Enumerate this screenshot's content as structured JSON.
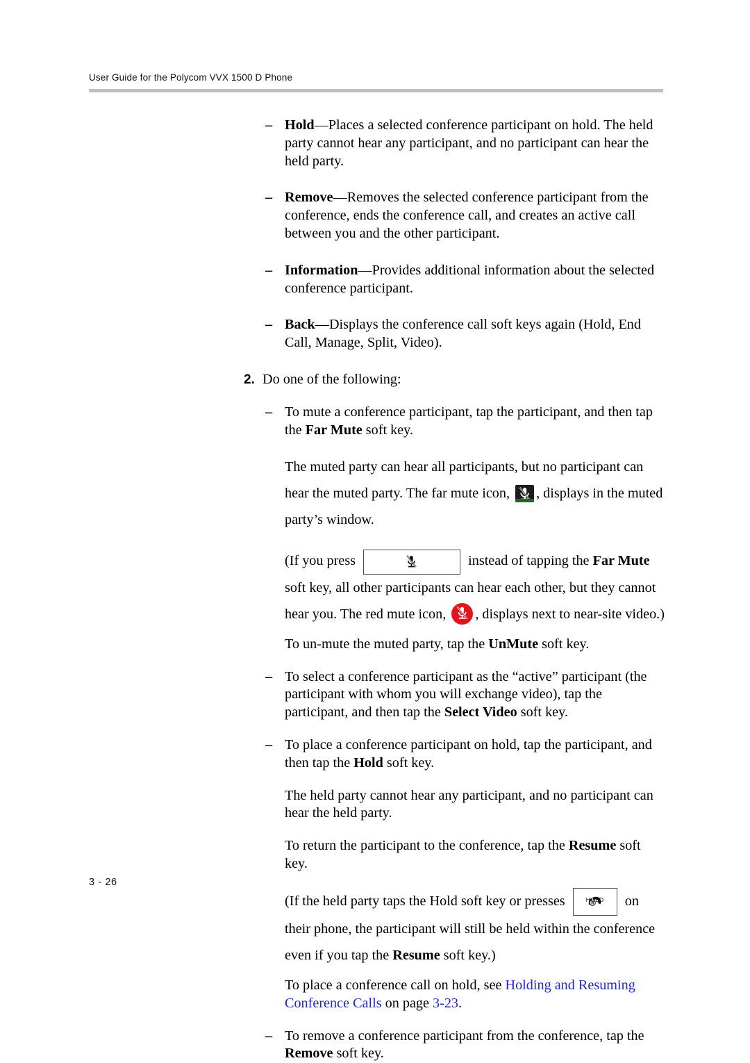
{
  "header": {
    "title": "User Guide for the Polycom VVX 1500 D Phone"
  },
  "footer": {
    "page_number": "3 - 26"
  },
  "colors": {
    "rule": "#bfbfbf",
    "link": "#2222dd",
    "red_mute": "#e8131a",
    "far_mute_bg": "#1c1c1c",
    "far_mute_accent": "#1d6b1d"
  },
  "bullets_softkeys": [
    {
      "marker": "–",
      "term": "Hold",
      "sep": "—",
      "text": "Places a selected conference participant on hold. The held party cannot hear any participant, and no participant can hear the held party."
    },
    {
      "marker": "–",
      "term": "Remove",
      "sep": "—",
      "text": "Removes the selected conference participant from the conference, ends the conference call, and creates an active call between you and the other participant."
    },
    {
      "marker": "–",
      "term": "Information",
      "sep": "—",
      "text": "Provides additional information about the selected conference participant."
    },
    {
      "marker": "–",
      "term": "Back",
      "sep": "—",
      "text": "Displays the conference call soft keys again (Hold, End Call, Manage, Split, Video)."
    }
  ],
  "step": {
    "number": "2.",
    "text": "Do one of the following:"
  },
  "mute_bullet": {
    "marker": "–",
    "lead": "To mute a conference participant, tap the participant, and then tap the ",
    "softkey": "Far Mute",
    "tail": " soft key."
  },
  "mute_body": {
    "line1": "The muted party can hear all participants, but no participant can hear",
    "line2_a": "the muted party. The far mute icon, ",
    "line2_b": ", displays in the muted",
    "line3": "party’s window."
  },
  "mute_key_note": {
    "a": "(If you press ",
    "b": " instead of tapping the ",
    "softkey": "Far Mute",
    "c": " soft key, all other participants can hear each other, but they cannot hear you. The red mute icon, ",
    "d": ", displays next to near-site video.)"
  },
  "unmute_line": {
    "a": "To un-mute the muted party, tap the ",
    "softkey": "UnMute",
    "b": " soft key."
  },
  "select_video_bullet": {
    "marker": "–",
    "a": "To select a conference participant as the “active” participant (the participant with whom you will exchange video), tap the participant, and then tap the ",
    "softkey": "Select Video",
    "b": " soft key."
  },
  "hold_bullet": {
    "marker": "–",
    "a": "To place a conference participant on hold, tap the participant, and then tap the ",
    "softkey": "Hold",
    "b": " soft key."
  },
  "hold_body": {
    "line1": "The held party cannot hear any participant, and no participant can hear the held party.",
    "line2_a": "To return the participant to the conference, tap the ",
    "line2_softkey": "Resume",
    "line2_b": " soft key."
  },
  "hold_key_note": {
    "a": "(If the held party taps the Hold soft key or presses ",
    "b": " on their phone, the participant will still be held within the conference even if you tap the ",
    "softkey": "Resume",
    "c": " soft key.)"
  },
  "crossref": {
    "lead": "To place a conference call on hold, see ",
    "link_text": "Holding and Resuming Conference Calls",
    "mid": " on page ",
    "page_link": "3-23",
    "end": "."
  },
  "remove_bullet": {
    "marker": "–",
    "a": "To remove a conference participant from the conference, tap the ",
    "softkey": "Remove",
    "b": " soft key."
  },
  "icons": {
    "far_mute": "far-mute-icon",
    "red_mute": "red-mute-icon",
    "mute_hard_key": "mute-key-icon",
    "hold_hard_key": "hold-key-icon",
    "hold_key_caption": "HOLD"
  }
}
